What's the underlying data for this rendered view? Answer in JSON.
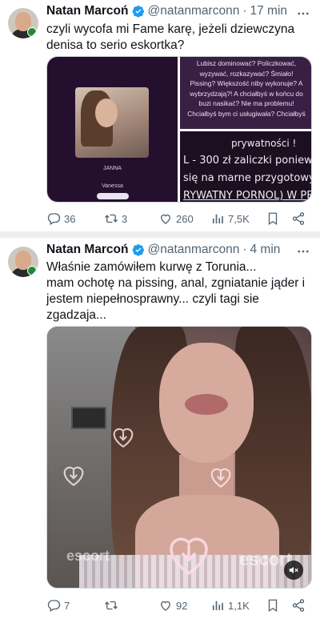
{
  "tweets": [
    {
      "author_name": "Natan Marcoń",
      "handle": "@natanmarconn",
      "separator": "·",
      "time": "17 min",
      "text_lines": [
        "czyli wycofa mi Fame karę, jeżeli dziewczyna",
        "denisa to serio eskortka?"
      ],
      "media": {
        "profile_card": {
          "name": "JANNA",
          "caption": "Vanessa"
        },
        "top_right_text": [
          "Lubisz dominować? Policzkować,",
          "wyzywać, rozkazywać? Śmiało!",
          "Pissing? Większość niby wykonuje? A",
          "wybrzydzają?! A chciałbyś w końcu do",
          "buzi nasikać? Nie ma problemu!",
          "Chciałbyś bym ci usługiwała? Chciałbyś"
        ],
        "bottom_right_text": [
          "prywatności !",
          "L - 300 zł zaliczki poniewa",
          "się na marne przygotowy",
          "RYWATNY PORNOL) W PF"
        ]
      },
      "actions": {
        "replies": "36",
        "retweets": "3",
        "likes": "260",
        "views": "7,5K"
      }
    },
    {
      "author_name": "Natan Marcoń",
      "handle": "@natanmarconn",
      "separator": "·",
      "time": "4 min",
      "text_lines": [
        "Właśnie zamówiłem kurwę z Torunia...",
        "mam ochotę na pissing, anal, zgniatanie jąder i",
        "jestem niepełnosprawny... czyli tagi sie",
        "zgadzaja..."
      ],
      "media": {
        "watermark": "escort"
      },
      "actions": {
        "replies": "7",
        "retweets": "",
        "likes": "92",
        "views": "1,1K"
      }
    }
  ],
  "colors": {
    "verified": "#1d9bf0",
    "muted_text": "#536471",
    "text": "#0f1419",
    "separator": "#eceef0"
  },
  "icons": [
    "verified-badge-icon",
    "more-options-icon",
    "reply-icon",
    "retweet-icon",
    "like-icon",
    "views-icon",
    "bookmark-icon",
    "share-icon",
    "mute-icon"
  ]
}
